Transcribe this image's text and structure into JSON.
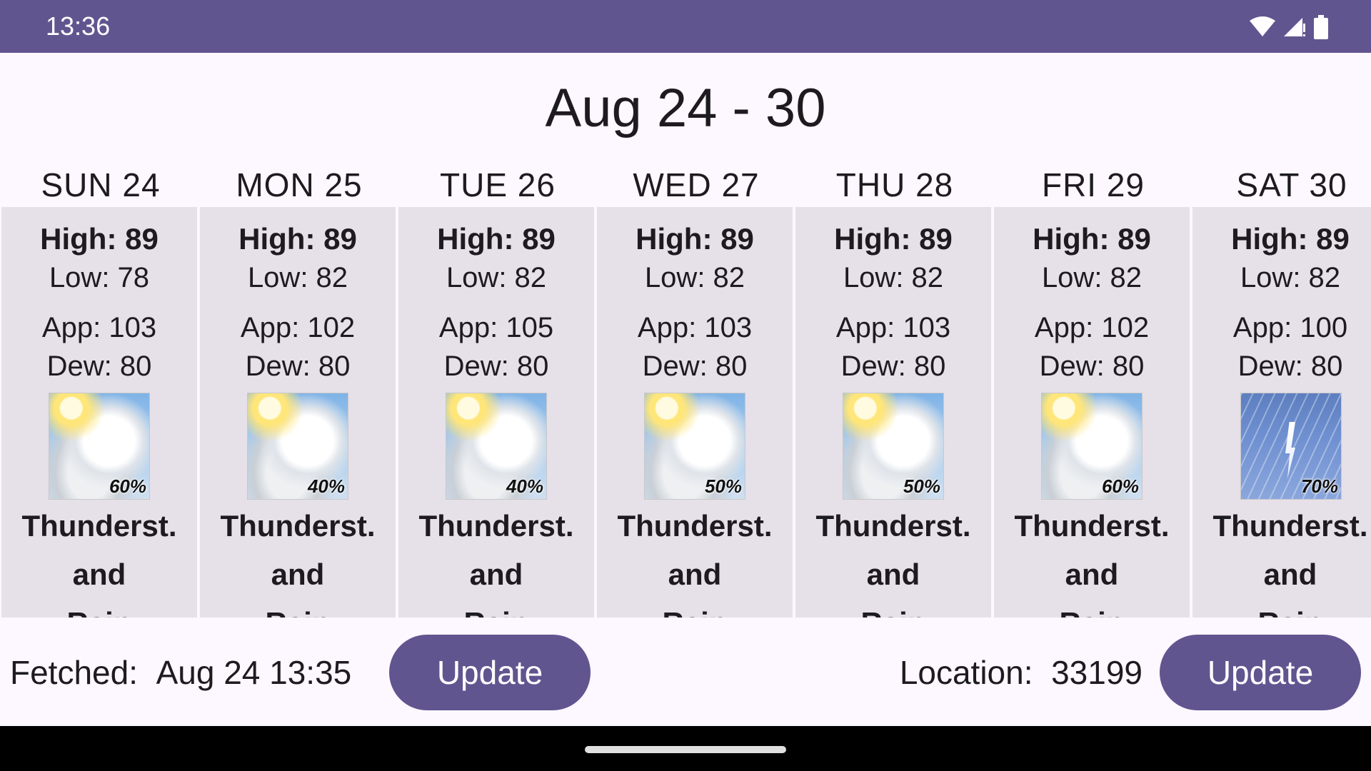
{
  "status": {
    "time": "13:36"
  },
  "title": "Aug 24 - 30",
  "days": [
    {
      "header": "SUN 24",
      "high": "High: 89",
      "low": "Low: 78",
      "app": "App: 103",
      "dew": "Dew: 80",
      "pop": "60%",
      "icon": "partly-cloudy-thunderstorm-icon",
      "cond": [
        "Thunderst.",
        "and",
        "Rain"
      ]
    },
    {
      "header": "MON 25",
      "high": "High: 89",
      "low": "Low: 82",
      "app": "App: 102",
      "dew": "Dew: 80",
      "pop": "40%",
      "icon": "partly-cloudy-thunderstorm-icon",
      "cond": [
        "Thunderst.",
        "and",
        "Rain"
      ]
    },
    {
      "header": "TUE 26",
      "high": "High: 89",
      "low": "Low: 82",
      "app": "App: 105",
      "dew": "Dew: 80",
      "pop": "40%",
      "icon": "partly-cloudy-thunderstorm-icon",
      "cond": [
        "Thunderst.",
        "and",
        "Rain"
      ]
    },
    {
      "header": "WED 27",
      "high": "High: 89",
      "low": "Low: 82",
      "app": "App: 103",
      "dew": "Dew: 80",
      "pop": "50%",
      "icon": "partly-cloudy-thunderstorm-icon",
      "cond": [
        "Thunderst.",
        "and",
        "Rain"
      ]
    },
    {
      "header": "THU 28",
      "high": "High: 89",
      "low": "Low: 82",
      "app": "App: 103",
      "dew": "Dew: 80",
      "pop": "50%",
      "icon": "partly-cloudy-thunderstorm-icon",
      "cond": [
        "Thunderst.",
        "and",
        "Rain"
      ]
    },
    {
      "header": "FRI 29",
      "high": "High: 89",
      "low": "Low: 82",
      "app": "App: 102",
      "dew": "Dew: 80",
      "pop": "60%",
      "icon": "partly-cloudy-thunderstorm-icon",
      "cond": [
        "Thunderst.",
        "and",
        "Rain"
      ]
    },
    {
      "header": "SAT 30",
      "high": "High: 89",
      "low": "Low: 82",
      "app": "App: 100",
      "dew": "Dew: 80",
      "pop": "70%",
      "icon": "thunderstorm-icon",
      "cond": [
        "Thunderst.",
        "and",
        "Rain"
      ]
    }
  ],
  "footer": {
    "fetched_label": "Fetched:",
    "fetched_value": "Aug 24 13:35",
    "update_label": "Update",
    "location_label": "Location:",
    "location_value": "33199",
    "update2_label": "Update"
  },
  "colors": {
    "accent": "#615590",
    "card": "#e6e0e9",
    "background": "#fdf7ff"
  }
}
